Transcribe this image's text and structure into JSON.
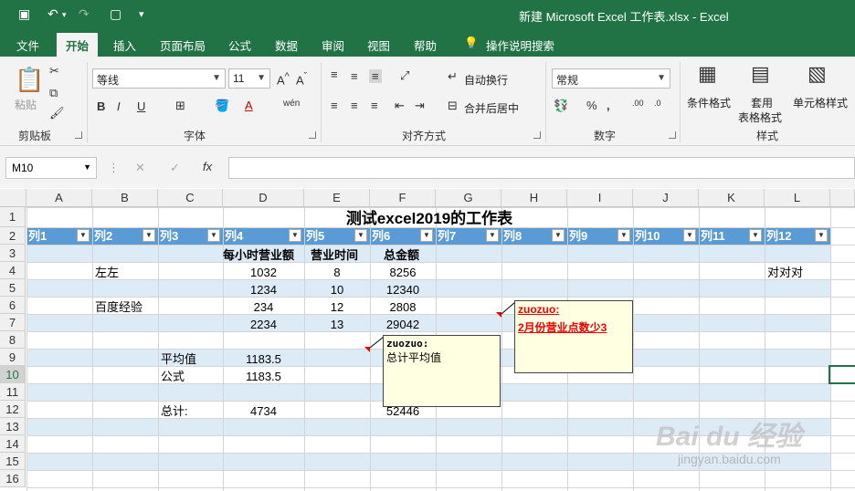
{
  "titlebar": {
    "title": "新建 Microsoft Excel 工作表.xlsx  -  Excel"
  },
  "tabs": [
    "文件",
    "开始",
    "插入",
    "页面布局",
    "公式",
    "数据",
    "审阅",
    "视图",
    "帮助",
    "操作说明搜索"
  ],
  "ribbon": {
    "clipboard": {
      "paste": "粘贴",
      "label": "剪贴板"
    },
    "font": {
      "name": "等线",
      "size": "11",
      "label": "字体"
    },
    "align": {
      "wrap": "自动换行",
      "merge": "合并后居中",
      "label": "对齐方式"
    },
    "number": {
      "format": "常规",
      "label": "数字"
    },
    "styles": {
      "cond": "条件格式",
      "table1": "套用",
      "table2": "表格格式",
      "cell": "单元格样式",
      "label": "样式"
    }
  },
  "namebox": "M10",
  "columns": [
    "A",
    "B",
    "C",
    "D",
    "E",
    "F",
    "G",
    "H",
    "I",
    "J",
    "K",
    "L"
  ],
  "rows": [
    "1",
    "2",
    "3",
    "4",
    "5",
    "6",
    "7",
    "8",
    "9",
    "10",
    "11",
    "12",
    "13",
    "14",
    "15",
    "16"
  ],
  "sheet": {
    "title": "测试excel2019的工作表",
    "headers": [
      "列1",
      "列2",
      "列3",
      "列4",
      "列5",
      "列6",
      "列7",
      "列8",
      "列9",
      "列10",
      "列11",
      "列12"
    ],
    "r3": {
      "d": "每小时营业额",
      "e": "营业时间",
      "f": "总金额"
    },
    "r4": {
      "b": "左左",
      "d": "1032",
      "e": "8",
      "f": "8256",
      "l": "对对对"
    },
    "r5": {
      "d": "1234",
      "e": "10",
      "f": "12340"
    },
    "r6": {
      "b": "百度经验",
      "d": "234",
      "e": "12",
      "f": "2808"
    },
    "r7": {
      "d": "2234",
      "e": "13",
      "f": "29042"
    },
    "r9": {
      "c": "平均值",
      "d": "1183.5"
    },
    "r10": {
      "c": "公式",
      "d": "1183.5"
    },
    "r12": {
      "c": "总计:",
      "d": "4734",
      "f": "52446"
    }
  },
  "comments": {
    "c1": {
      "author": "zuozuo:",
      "text": "总计平均值"
    },
    "c2": {
      "author": "zuozuo:",
      "text": "2月份营业点数少3"
    }
  },
  "watermark": {
    "brand": "Bai du 经验",
    "url": "jingyan.baidu.com"
  }
}
